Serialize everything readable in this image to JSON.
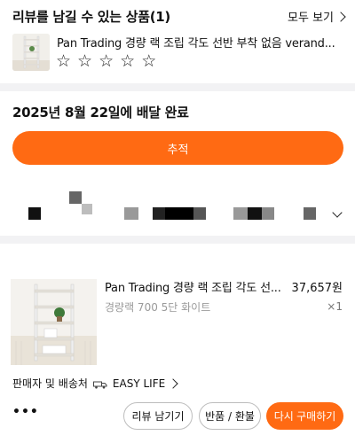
{
  "review_section": {
    "title": "리뷰를 남길 수 있는 상품(1)",
    "see_all_label": "모두 보기",
    "product_title": "Pan Trading 경량 랙 조립 각도 선반 부착 없음 verand...",
    "rating_empty_stars": 5
  },
  "delivery_section": {
    "status": "2025년 8월 22일에 배달 완료",
    "track_button_label": "추적"
  },
  "order_item": {
    "name": "Pan Trading 경량 랙 조립 각도 선...",
    "price": "37,657원",
    "option": "경량랙 700 5단 화이트",
    "quantity": "×1"
  },
  "seller": {
    "label": "판매자 및 배송처",
    "name": "EASY LIFE"
  },
  "actions": {
    "more_label": "•••",
    "review_label": "리뷰 남기기",
    "return_label": "반품 / 환불",
    "rebuy_label": "다시 구매하기"
  },
  "colors": {
    "accent": "#ff6a13",
    "divider": "#f2f2f4",
    "muted_text": "#9a9a9a"
  }
}
